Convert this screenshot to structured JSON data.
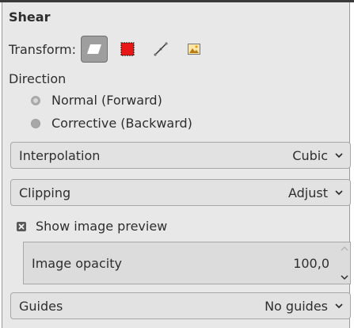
{
  "title": "Shear",
  "transform": {
    "label": "Transform:",
    "icons": [
      "shear-layer-icon",
      "selection-icon",
      "path-icon",
      "image-icon"
    ]
  },
  "direction": {
    "label": "Direction",
    "options": [
      "Normal (Forward)",
      "Corrective (Backward)"
    ],
    "selected": "Normal (Forward)"
  },
  "interpolation": {
    "label": "Interpolation",
    "value": "Cubic"
  },
  "clipping": {
    "label": "Clipping",
    "value": "Adjust"
  },
  "preview": {
    "label": "Show image preview",
    "checked": true
  },
  "opacity": {
    "label": "Image opacity",
    "value": "100,0"
  },
  "guides": {
    "label": "Guides",
    "value": "No guides"
  },
  "colors": {
    "panel_bg": "#e8e8e8",
    "active_button": "#9e9e9e",
    "selection_red": "#e81616"
  }
}
